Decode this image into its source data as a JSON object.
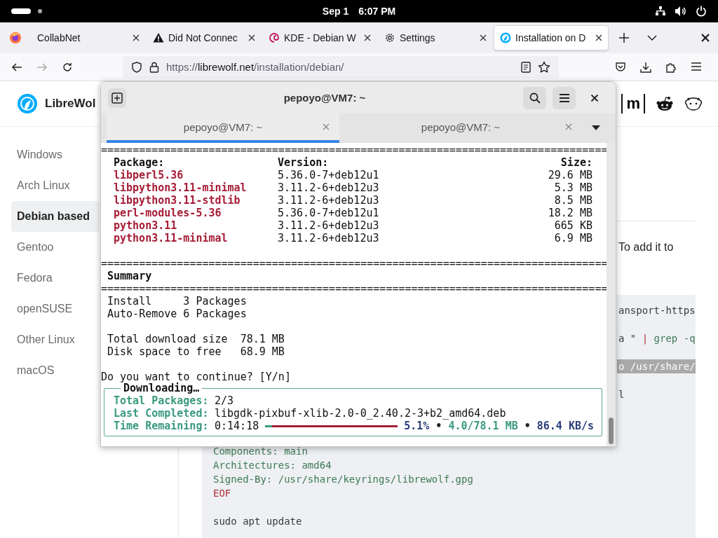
{
  "top_bar": {
    "date": "Sep 1",
    "time": "6:07 PM"
  },
  "browser_tabs": [
    {
      "title": "CollabNet",
      "kind": "blank",
      "selected": false
    },
    {
      "title": "Did Not Connec",
      "kind": "warning",
      "selected": false
    },
    {
      "title": "KDE - Debian W",
      "kind": "kde",
      "selected": false
    },
    {
      "title": "Settings",
      "kind": "settings",
      "selected": false
    },
    {
      "title": "Installation on D",
      "kind": "librewolf",
      "selected": true
    }
  ],
  "address_bar": {
    "scheme": "https://",
    "domain": "librewolf.net",
    "path": "/installation/debian/"
  },
  "site": {
    "name": "LibreWol",
    "social_links": [
      {
        "kind": "matrix",
        "text": "m"
      },
      {
        "kind": "reddit"
      },
      {
        "kind": "lemmy"
      }
    ]
  },
  "sidebar": {
    "items": [
      {
        "label": "Windows",
        "selected": false
      },
      {
        "label": "Arch Linux",
        "selected": false
      },
      {
        "label": "Debian based",
        "selected": true
      },
      {
        "label": "Gentoo",
        "selected": false
      },
      {
        "label": "Fedora",
        "selected": false
      },
      {
        "label": "openSUSE",
        "selected": false
      },
      {
        "label": "Other Linux",
        "selected": false
      },
      {
        "label": "macOS",
        "selected": false
      }
    ]
  },
  "content": {
    "paragraph": "To add it to",
    "code_fragments": [
      {
        "highlighted": false,
        "segments": [
          {
            "text": "ansport-https",
            "kind": "plain"
          }
        ]
      },
      {
        "highlighted": false,
        "segments": [
          {
            "text": "a \" ",
            "kind": "plain"
          },
          {
            "text": "|",
            "kind": "keyword"
          },
          {
            "text": " grep -q",
            "kind": "string"
          }
        ]
      },
      {
        "highlighted": true,
        "segments": [
          {
            "text": "o /usr/share/",
            "kind": "plain"
          }
        ]
      },
      {
        "highlighted": false,
        "segments": [
          {
            "text": "l",
            "kind": "plain"
          }
        ]
      }
    ],
    "code_lines": [
      {
        "segments": [
          {
            "text": "Components: main",
            "kind": "string"
          }
        ]
      },
      {
        "segments": [
          {
            "text": "Architectures: amd64",
            "kind": "string"
          }
        ]
      },
      {
        "segments": [
          {
            "text": "Signed-By: /usr/share/keyrings/librewolf.gpg",
            "kind": "string"
          }
        ]
      },
      {
        "segments": [
          {
            "text": "EOF",
            "kind": "keyword"
          }
        ]
      }
    ],
    "code_after": [
      {
        "segments": [
          {
            "text": "sudo apt update",
            "kind": "plain"
          }
        ]
      }
    ]
  },
  "terminal": {
    "title": "pepoyo@VM7: ~",
    "tabs": [
      {
        "title": "pepoyo@VM7: ~",
        "selected": true
      },
      {
        "title": "pepoyo@VM7: ~",
        "selected": false
      }
    ],
    "output": [
      {
        "kind": "rule",
        "text": "================================================================================"
      },
      {
        "kind": "table",
        "columns": [
          "Package:",
          "Version:",
          "Size:"
        ],
        "rows": [
          [
            "libperl5.36",
            "5.36.0-7+deb12u1",
            "29.6 MB"
          ],
          [
            "libpython3.11-minimal",
            "3.11.2-6+deb12u3",
            "5.3 MB"
          ],
          [
            "libpython3.11-stdlib",
            "3.11.2-6+deb12u3",
            "8.5 MB"
          ],
          [
            "perl-modules-5.36",
            "5.36.0-7+deb12u1",
            "18.2 MB"
          ],
          [
            "python3.11",
            "3.11.2-6+deb12u3",
            "665 KB"
          ],
          [
            "python3.11-minimal",
            "3.11.2-6+deb12u3",
            "6.9 MB"
          ]
        ]
      },
      {
        "kind": "blank"
      },
      {
        "kind": "rule",
        "text": "================================================================================"
      },
      {
        "kind": "heading",
        "text": "Summary"
      },
      {
        "kind": "rule",
        "text": "================================================================================"
      },
      {
        "kind": "text",
        "text": "Install     3 Packages"
      },
      {
        "kind": "text",
        "text": "Auto-Remove 6 Packages"
      },
      {
        "kind": "blank"
      },
      {
        "kind": "text",
        "text": "Total download size  78.1 MB"
      },
      {
        "kind": "text",
        "text": "Disk space to free   68.9 MB"
      },
      {
        "kind": "blank"
      },
      {
        "kind": "prompt",
        "text": "Do you want to continue? [Y/n]"
      },
      {
        "kind": "progress",
        "title": "Downloading…",
        "fields": [
          {
            "label": "Total Packages:",
            "value": "2/3"
          },
          {
            "label": "Last Completed:",
            "value": "libgdk-pixbuf-xlib-2.0-0_2.40.2-3+b2_amd64.deb"
          }
        ],
        "remaining_label": "Time Remaining:",
        "remaining": "0:14:18",
        "level": 0.051,
        "stats": [
          {
            "text": "5.1%",
            "kind": "percent"
          },
          {
            "text": "•",
            "kind": "dot"
          },
          {
            "text": "4.0/78.1 MB",
            "kind": "size"
          },
          {
            "text": "•",
            "kind": "dot"
          },
          {
            "text": "86.4 KB/s",
            "kind": "rate"
          }
        ]
      }
    ]
  }
}
